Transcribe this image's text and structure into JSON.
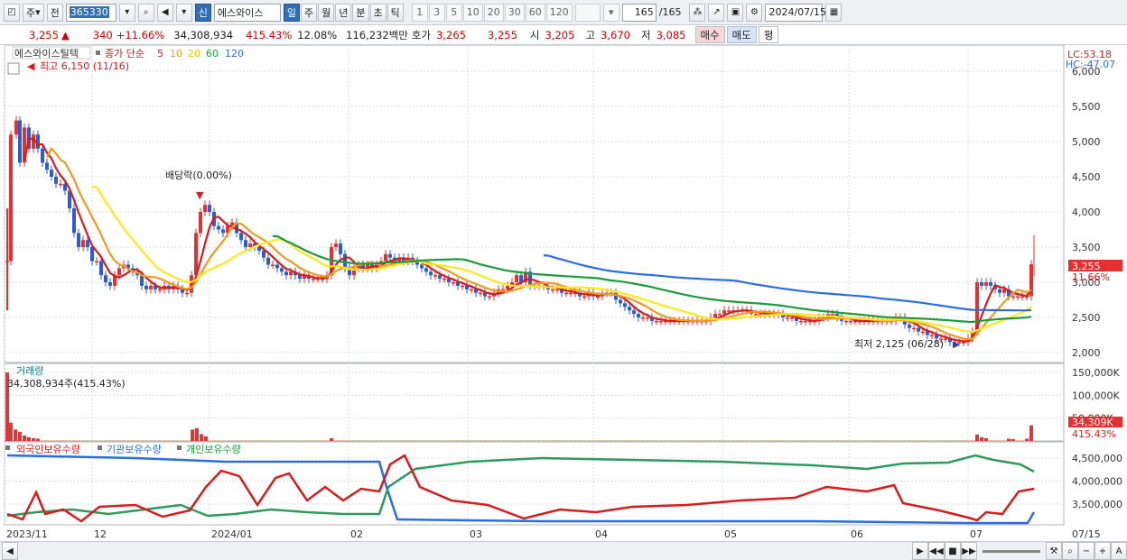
{
  "toolbar": {
    "period_week": "주",
    "prev_label": "전",
    "code": "365330",
    "badge_new": "신",
    "stock_name": "에스와이스",
    "periods": [
      "일",
      "주",
      "월",
      "년",
      "분",
      "초",
      "틱"
    ],
    "selected_period": "일",
    "ticks": [
      "1",
      "3",
      "5",
      "10",
      "20",
      "30",
      "60",
      "120"
    ],
    "count": "165",
    "count_total": "/165",
    "date": "2024/07/15"
  },
  "quote": {
    "price": "3,255",
    "arrow": "▲",
    "change": "340",
    "change_pct": "+11.66%",
    "volume": "34,308,934",
    "volume_pct": "415.43%",
    "turnover": "12.08%",
    "amount": "116,232백만",
    "ask_label": "호가",
    "ask1": "3,265",
    "ask2": "3,255",
    "open_label": "시",
    "open": "3,205",
    "high_label": "고",
    "high": "3,670",
    "low_label": "저",
    "low": "3,085",
    "buy_btn": "매수",
    "sell_btn": "매도",
    "eval_btn": "평"
  },
  "price_panel": {
    "legend_name": "에스와이스틸텍",
    "legend_ma": "종가 단순",
    "ma_periods": [
      "5",
      "10",
      "20",
      "60",
      "120"
    ],
    "ma_colors": [
      "#d81b1b",
      "#f29a1f",
      "#ffe81a",
      "#1a9c3a",
      "#2a6de0"
    ],
    "high_marker": "최고 6,150 (11/16)",
    "low_marker": "최저 2,125 (06/28)",
    "dividend": "배당락(0.00%)",
    "lc": "LC:53.18",
    "hc": "HC:-47.07",
    "y_ticks": [
      "6,000",
      "5,500",
      "5,000",
      "4,500",
      "4,000",
      "3,500",
      "3,000",
      "2,500",
      "2,000"
    ],
    "current_price_tag": "3,255",
    "current_pct_tag": "11.66%"
  },
  "volume_panel": {
    "title": "거래량",
    "info": "34,308,934주(415.43%)",
    "y_ticks": [
      "150,000K",
      "100,000K",
      "50,000K"
    ],
    "current_tag": "34,309K",
    "current_pct": "415.43%"
  },
  "holder_panel": {
    "legend": [
      "외국인보유수량",
      "기관보유수량",
      "개인보유수량"
    ],
    "colors": [
      "#d81b1b",
      "#2a6de0",
      "#1a9c3a"
    ],
    "y_ticks": [
      "4,500,000",
      "4,000,000",
      "3,500,000"
    ]
  },
  "x_axis": [
    "2023/11",
    "12",
    "2024/01",
    "02",
    "03",
    "04",
    "05",
    "06",
    "07",
    "07/15"
  ]
}
